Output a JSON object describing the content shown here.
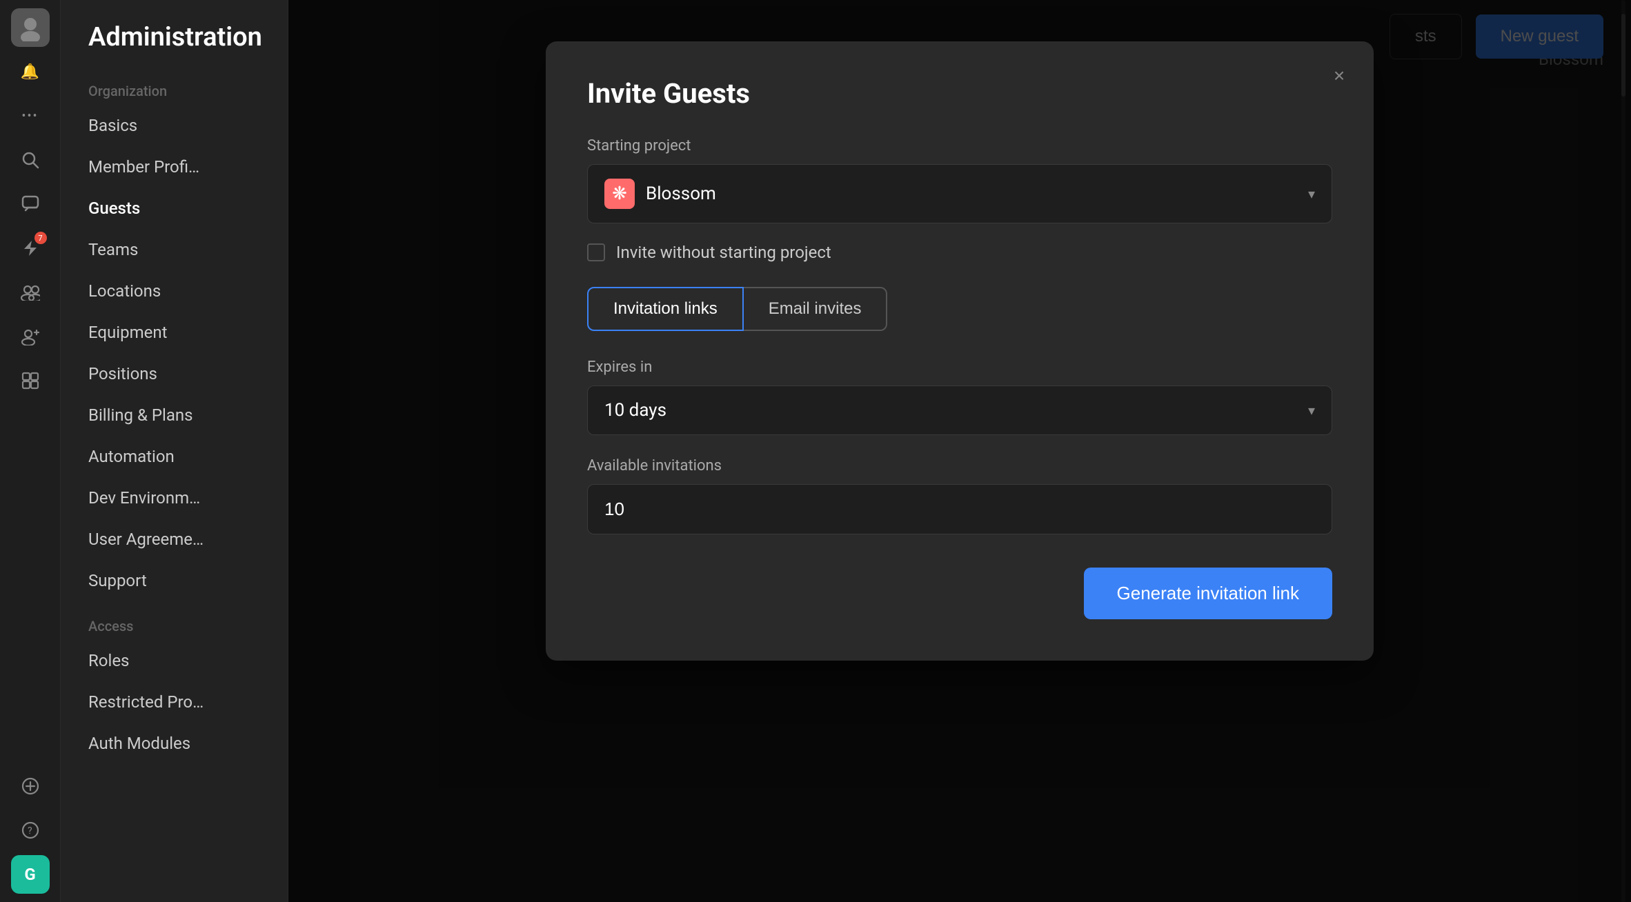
{
  "app": {
    "title": "Administration"
  },
  "icon_sidebar": {
    "avatar_initials": "",
    "notification_icon": "🔔",
    "more_icon": "•••",
    "search_icon": "🔍",
    "chat_icon": "💬",
    "lightning_icon": "⚡",
    "lightning_badge": "7",
    "people_icon": "👥",
    "guests_icon": "👤",
    "puzzle_icon": "🧩",
    "add_icon": "+",
    "help_icon": "?",
    "g_icon": "G"
  },
  "nav": {
    "section_organization": "Organization",
    "items_org": [
      "Basics",
      "Member Profi…",
      "Guests",
      "Teams",
      "Locations",
      "Equipment",
      "Positions",
      "Billing & Plans",
      "Automation",
      "Dev Environm…",
      "User Agreeme…",
      "Support"
    ],
    "section_access": "Access",
    "items_access": [
      "Roles",
      "Restricted Pro…",
      "Auth Modules"
    ]
  },
  "top_bar": {
    "guests_btn_label": "sts",
    "new_guest_label": "New guest",
    "blossom_label": "Blossom"
  },
  "modal": {
    "title": "Invite Guests",
    "close_label": "×",
    "starting_project_label": "Starting project",
    "project_icon": "❋",
    "project_name": "Blossom",
    "invite_without_label": "Invite without starting project",
    "tab_invitation_links": "Invitation links",
    "tab_email_invites": "Email invites",
    "expires_label": "Expires in",
    "expires_value": "10 days",
    "available_label": "Available invitations",
    "available_value": "10",
    "generate_btn_label": "Generate invitation link"
  }
}
